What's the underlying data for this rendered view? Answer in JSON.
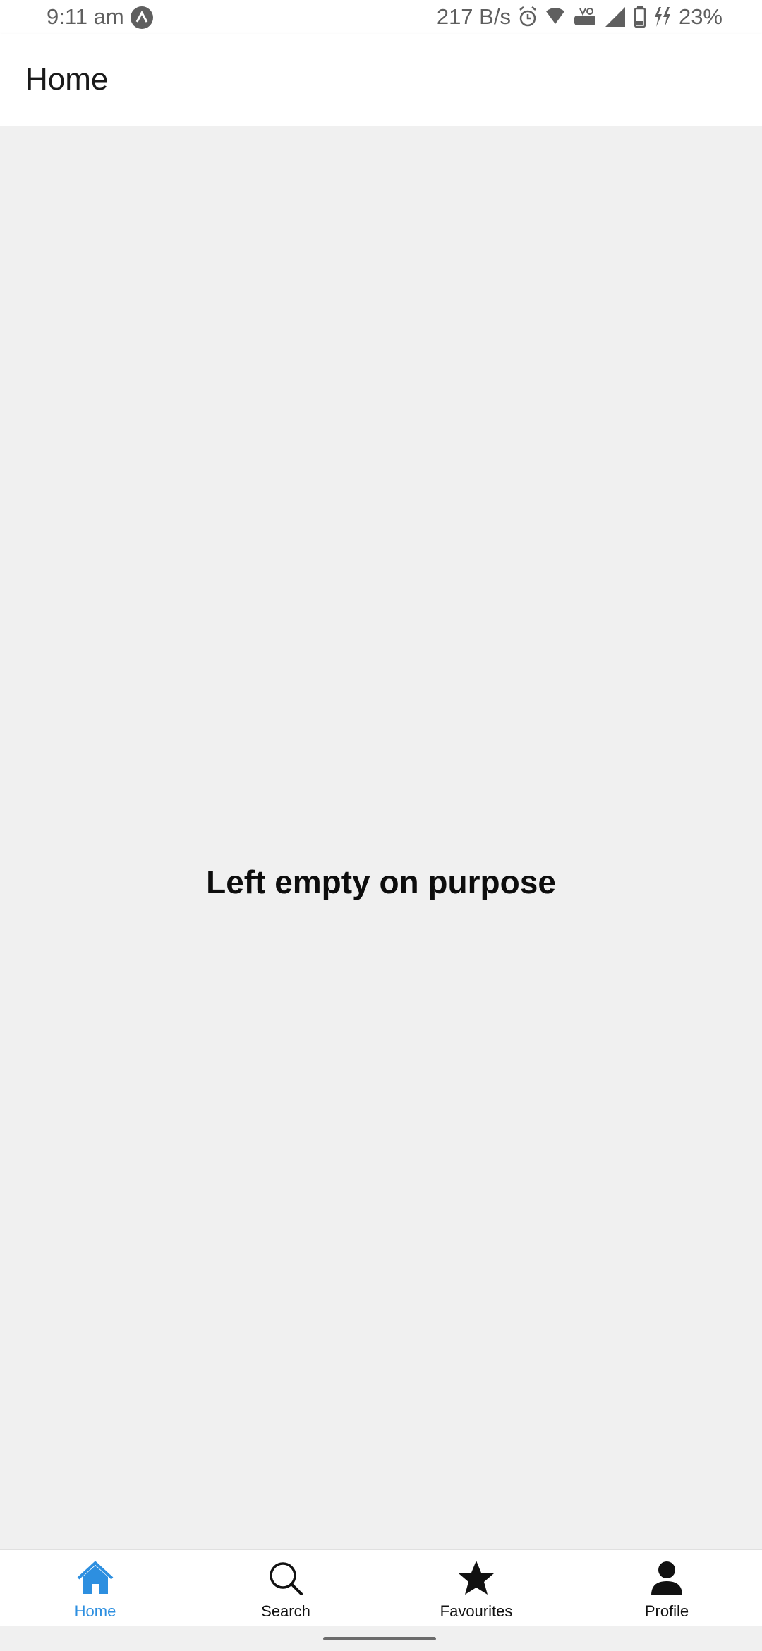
{
  "status_bar": {
    "time": "9:11 am",
    "network_speed": "217 B/s",
    "battery_percent": "23%",
    "icons": [
      "app-notification-icon",
      "alarm-icon",
      "wifi-icon",
      "volte-icon",
      "cellular-signal-icon",
      "battery-icon",
      "charging-icon"
    ]
  },
  "header": {
    "title": "Home"
  },
  "main": {
    "message": "Left empty on purpose"
  },
  "bottom_nav": {
    "items": [
      {
        "label": "Home",
        "icon": "home-icon",
        "active": true
      },
      {
        "label": "Search",
        "icon": "search-icon",
        "active": false
      },
      {
        "label": "Favourites",
        "icon": "star-icon",
        "active": false
      },
      {
        "label": "Profile",
        "icon": "person-icon",
        "active": false
      }
    ]
  },
  "colors": {
    "accent": "#2d8fe0",
    "background": "#f0f0f0",
    "header_background": "#ffffff"
  }
}
